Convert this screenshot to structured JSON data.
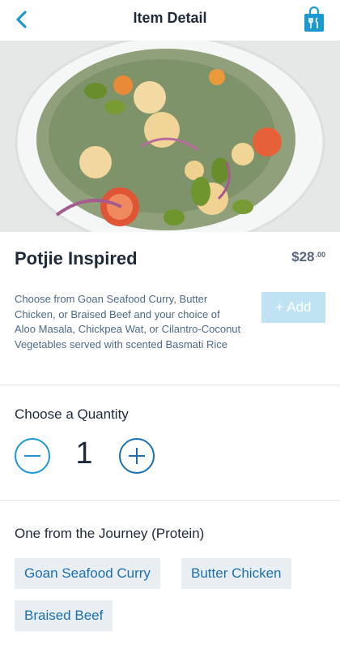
{
  "header": {
    "title": "Item Detail"
  },
  "item": {
    "name": "Potjie Inspired",
    "price_dollars": "$28",
    "price_cents": ".00",
    "description": "Choose from Goan Seafood Curry, Butter Chicken, or Braised Beef and your choice of Aloo Masala, Chickpea Wat, or Cilantro-Coconut Vegetables served with scented Basmati Rice",
    "add_label": "+ Add"
  },
  "quantity": {
    "label": "Choose a Quantity",
    "value": "1"
  },
  "options": {
    "label": "One from the Journey (Protein)",
    "choices": [
      "Goan Seafood Curry",
      "Butter Chicken",
      "Braised Beef"
    ]
  },
  "colors": {
    "accent": "#1b99d0",
    "add_button": "#bfe3f3",
    "chip_bg": "#e9eef3"
  },
  "icons": {
    "back": "chevron-left-icon",
    "bag": "shopping-bag-icon"
  }
}
